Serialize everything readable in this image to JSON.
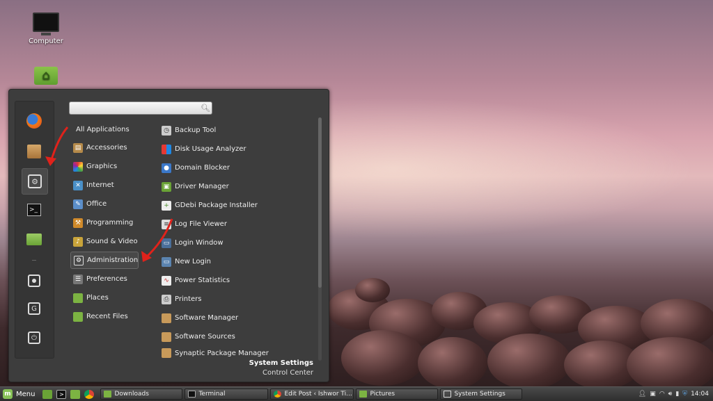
{
  "desktop": {
    "icons": [
      {
        "label": "Computer"
      }
    ]
  },
  "menu": {
    "search": {
      "value": "",
      "placeholder": ""
    },
    "categories": [
      {
        "label": "All Applications"
      },
      {
        "label": "Accessories"
      },
      {
        "label": "Graphics"
      },
      {
        "label": "Internet"
      },
      {
        "label": "Office"
      },
      {
        "label": "Programming"
      },
      {
        "label": "Sound & Video"
      },
      {
        "label": "Administration"
      },
      {
        "label": "Preferences"
      },
      {
        "label": "Places"
      },
      {
        "label": "Recent Files"
      }
    ],
    "selected_category": "Administration",
    "apps": [
      {
        "label": "Backup Tool"
      },
      {
        "label": "Disk Usage Analyzer"
      },
      {
        "label": "Domain Blocker"
      },
      {
        "label": "Driver Manager"
      },
      {
        "label": "GDebi Package Installer"
      },
      {
        "label": "Log File Viewer"
      },
      {
        "label": "Login Window"
      },
      {
        "label": "New Login"
      },
      {
        "label": "Power Statistics"
      },
      {
        "label": "Printers"
      },
      {
        "label": "Software Manager"
      },
      {
        "label": "Software Sources"
      },
      {
        "label": "Synaptic Package Manager"
      }
    ],
    "info": {
      "title": "System Settings",
      "subtitle": "Control Center"
    }
  },
  "taskbar": {
    "menu_label": "Menu",
    "windows": [
      {
        "label": "Downloads"
      },
      {
        "label": "Terminal"
      },
      {
        "label": "Edit Post ‹ Ishwor Ti..."
      },
      {
        "label": "Pictures"
      },
      {
        "label": "System Settings"
      }
    ],
    "clock": "14:04"
  },
  "colors": {
    "accent": "#87c157",
    "arrow": "#e0221b",
    "panel": "#3d3d3d"
  }
}
